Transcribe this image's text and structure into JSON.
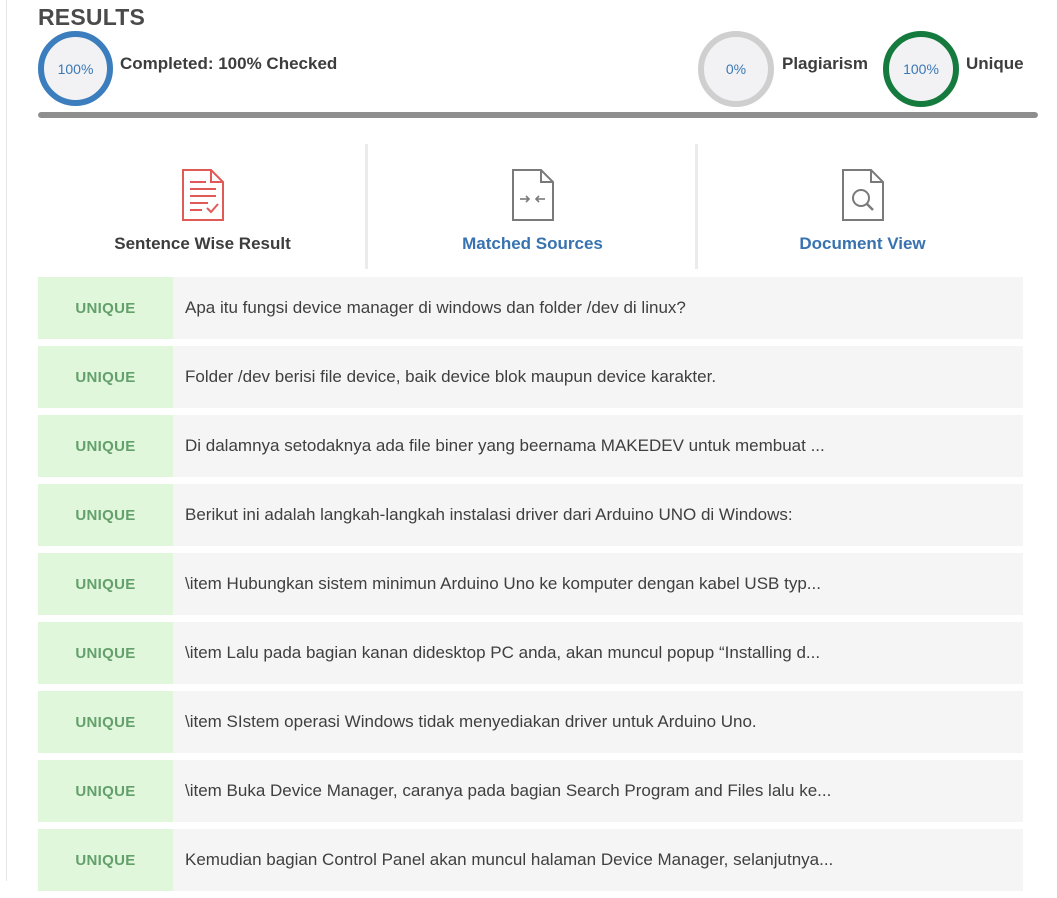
{
  "header": {
    "title": "RESULTS"
  },
  "stats": {
    "completed": {
      "percent": "100%",
      "label": "Completed: 100% Checked",
      "color": "#3b7dbd"
    },
    "plagiarism": {
      "percent": "0%",
      "label": "Plagiarism",
      "color": "#cfcfcf"
    },
    "unique": {
      "percent": "100%",
      "label": "Unique",
      "color": "#157a3d"
    },
    "progress": 1.0
  },
  "tabs": [
    {
      "label": "Sentence Wise Result",
      "icon": "document-check-icon",
      "active": true
    },
    {
      "label": "Matched Sources",
      "icon": "document-compare-icon",
      "active": false
    },
    {
      "label": "Document View",
      "icon": "document-search-icon",
      "active": false
    }
  ],
  "rows": [
    {
      "status": "UNIQUE",
      "text": "Apa itu fungsi device manager di windows dan folder /dev di linux?"
    },
    {
      "status": "UNIQUE",
      "text": "Folder /dev berisi file device, baik device blok maupun device karakter."
    },
    {
      "status": "UNIQUE",
      "text": "Di dalamnya setodaknya ada file biner yang beernama MAKEDEV untuk membuat ..."
    },
    {
      "status": "UNIQUE",
      "text": "Berikut ini adalah langkah-langkah instalasi driver dari Arduino UNO di Windows:"
    },
    {
      "status": "UNIQUE",
      "text": "\\item Hubungkan sistem minimun Arduino Uno ke komputer dengan kabel USB typ..."
    },
    {
      "status": "UNIQUE",
      "text": "\\item Lalu pada bagian kanan didesktop PC anda, akan muncul popup “Installing d..."
    },
    {
      "status": "UNIQUE",
      "text": "\\item SIstem operasi Windows tidak menyediakan driver untuk Arduino Uno."
    },
    {
      "status": "UNIQUE",
      "text": "\\item Buka Device Manager, caranya pada bagian Search Program and Files lalu ke..."
    },
    {
      "status": "UNIQUE",
      "text": "Kemudian bagian Control Panel akan muncul halaman Device Manager, selanjutnya..."
    }
  ]
}
